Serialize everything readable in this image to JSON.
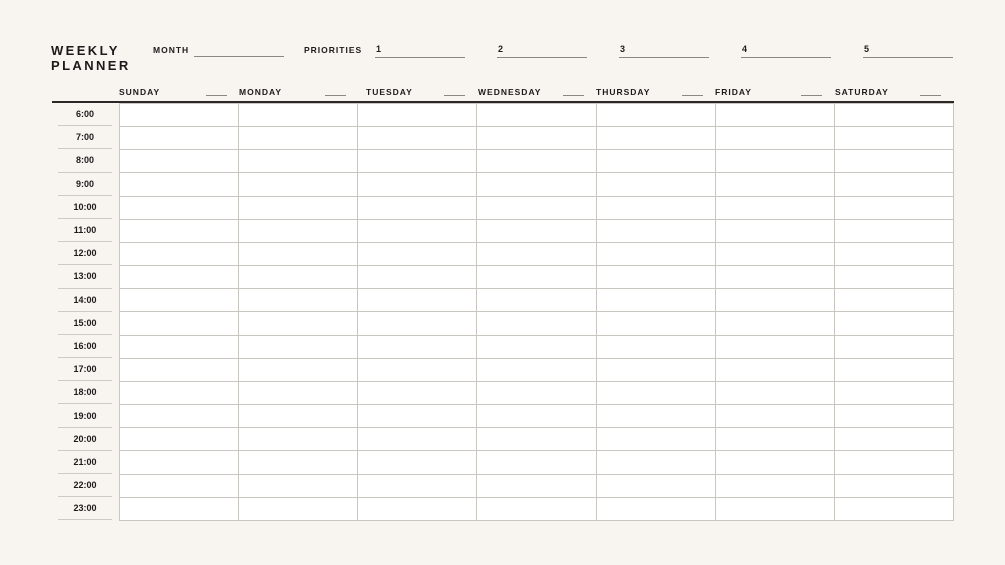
{
  "title_lines": [
    "WEEKLY",
    "PLANNER"
  ],
  "month_label": "MONTH",
  "priorities_label": "PRIORITIES",
  "priorities": [
    "1",
    "2",
    "3",
    "4",
    "5"
  ],
  "days": [
    "SUNDAY",
    "MONDAY",
    "TUESDAY",
    "WEDNESDAY",
    "THURSDAY",
    "FRIDAY",
    "SATURDAY"
  ],
  "times": [
    "6:00",
    "7:00",
    "8:00",
    "9:00",
    "10:00",
    "11:00",
    "12:00",
    "13:00",
    "14:00",
    "15:00",
    "16:00",
    "17:00",
    "18:00",
    "19:00",
    "20:00",
    "21:00",
    "22:00",
    "23:00"
  ]
}
